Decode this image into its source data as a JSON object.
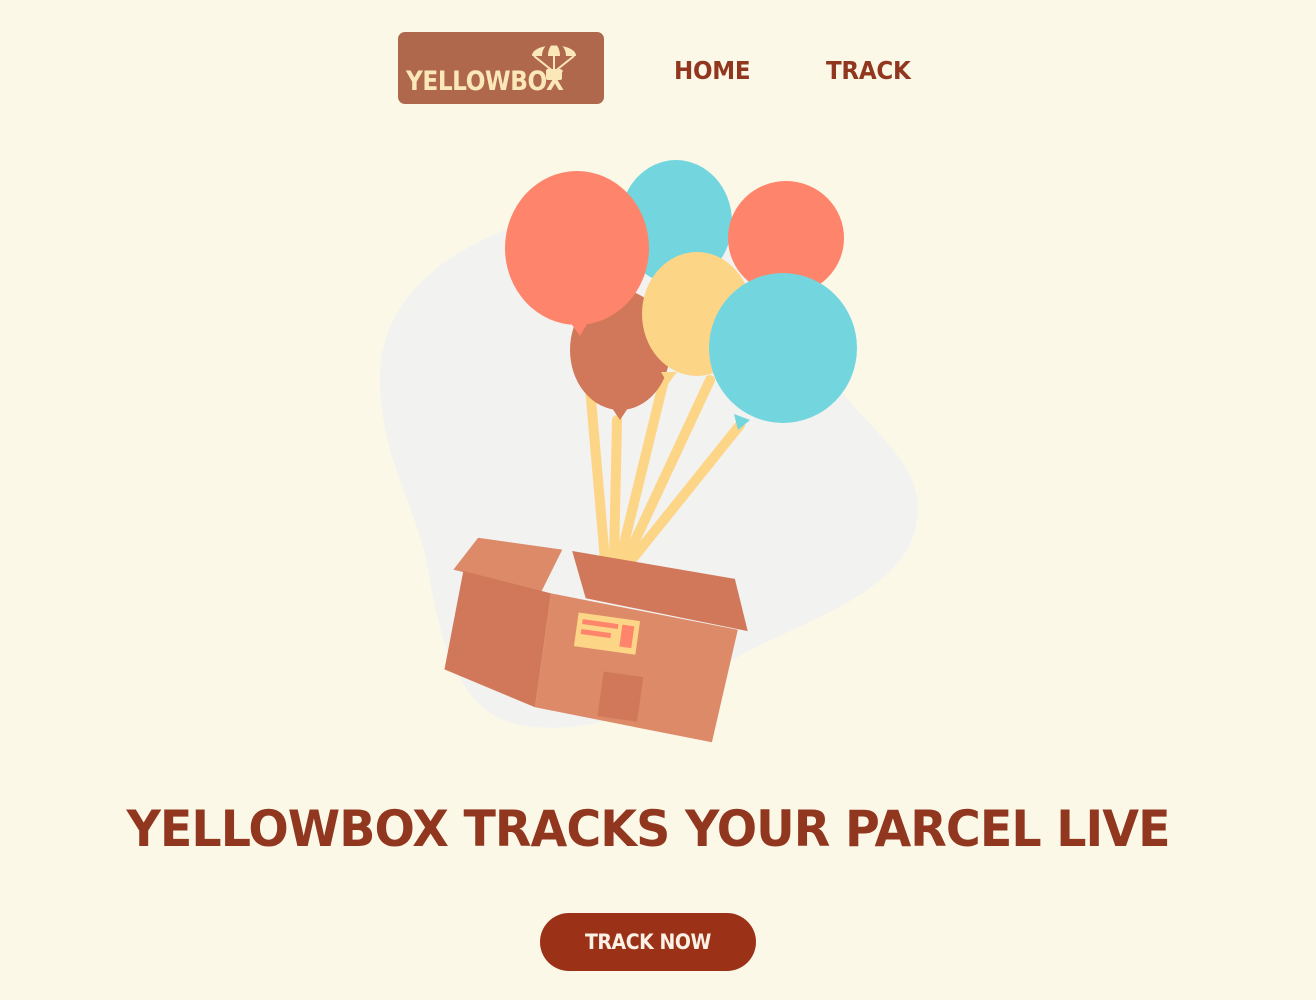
{
  "brand": {
    "logo_text": "YELLOWBOX",
    "logo_bg": "#b0684c",
    "logo_text_color": "#fbe8b8"
  },
  "nav": {
    "items": [
      {
        "label": "HOME"
      },
      {
        "label": "TRACK"
      }
    ],
    "color": "#92371f"
  },
  "hero": {
    "illustration": "parcel-box-with-balloons",
    "headline": "YELLOWBOX TRACKS YOUR PARCEL LIVE",
    "cta_label": "TRACK NOW"
  },
  "colors": {
    "background": "#fbf8e8",
    "accent": "#9b3218",
    "balloon_coral": "#fe846b",
    "balloon_teal": "#73d6de",
    "balloon_yellow": "#fdd587",
    "balloon_brown": "#d2785a",
    "box": "#d68663"
  }
}
